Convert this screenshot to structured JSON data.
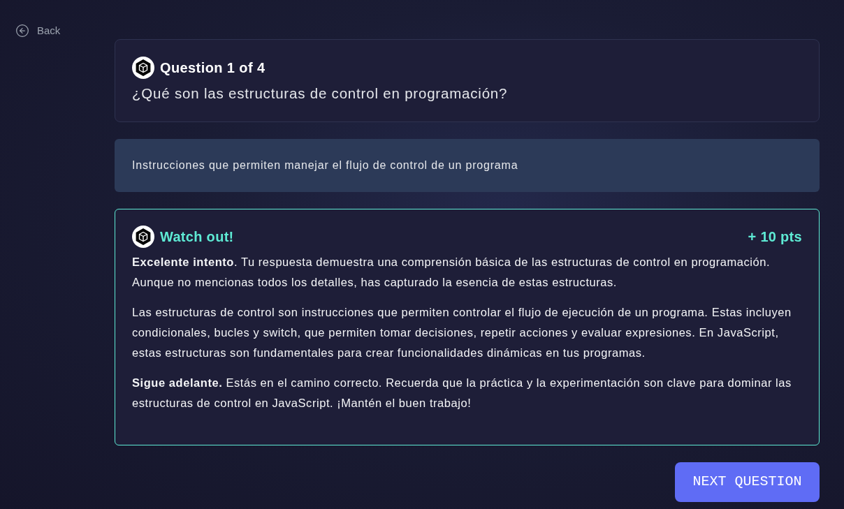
{
  "back_link": {
    "label": "Back"
  },
  "question": {
    "title": "Question 1 of 4",
    "text": "¿Qué son las estructuras de control en programación?"
  },
  "answer": {
    "value": "Instrucciones que permiten manejar el flujo de control de un programa"
  },
  "feedback": {
    "kind": "warning",
    "title": "Watch out!",
    "points": "+ 10 pts",
    "paragraphs": [
      "**Excelente intento**. Tu respuesta demuestra una comprensión básica de las estructuras de control en programación. Aunque no mencionas todos los detalles, has capturado la esencia de estas estructuras.",
      "Las estructuras de control son instrucciones que permiten controlar el flujo de ejecución de un programa. Estas incluyen condicionales, bucles y switch, que permiten tomar decisiones, repetir acciones y evaluar expresiones. En JavaScript, estas estructuras son fundamentales para crear funcionalidades dinámicas en tus programas.",
      "**Sigue adelante.** Estás en el camino correcto. Recuerda que la práctica y la experimentación son clave para dominar las estructuras de control en JavaScript. ¡Mantén el buen trabajo!"
    ]
  },
  "next_button": {
    "label": "NEXT QUESTION"
  }
}
